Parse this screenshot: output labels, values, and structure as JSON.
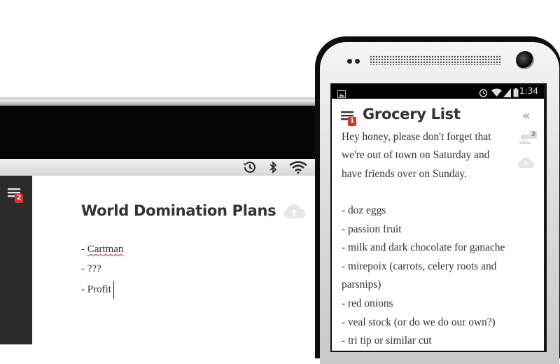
{
  "tablet": {
    "menu_badge": "2",
    "note_title": "World Domination Plans",
    "note_lines": [
      "- Cartman",
      "- ???",
      "- Profit"
    ],
    "misspelled_word": "Cartman",
    "status_icons": [
      "history-icon",
      "bluetooth-icon",
      "wifi-icon"
    ],
    "sync_icon": "cloud-icon"
  },
  "phone": {
    "status_time": "1:34",
    "status_icons": [
      "image-notification-icon",
      "alarm-icon",
      "wifi-icon",
      "signal-icon",
      "battery-icon"
    ],
    "menu_badge": "1",
    "note_title": "Grocery List",
    "collapse_icon": "double-chevron-left-icon",
    "shared_count": "3",
    "lines": [
      "Hey honey, please don't forget that",
      "we're out of town on Saturday and",
      "have friends over on Sunday.",
      "",
      "- doz eggs",
      "- passion fruit",
      "- milk and dark chocolate for ganache",
      "- mirepoix (carrots, celery roots and",
      "parsnips)",
      "- red onions",
      "- veal stock (or do we do our own?)",
      "- tri tip or similar cut"
    ]
  },
  "colors": {
    "badge": "#d9342b",
    "title_text": "#333333",
    "sidebar": "#2b2b2b"
  }
}
